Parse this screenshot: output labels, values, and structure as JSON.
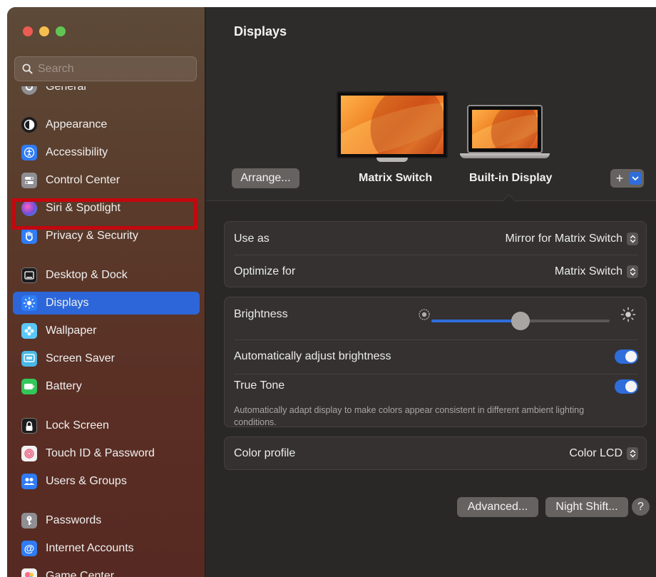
{
  "window": {
    "traffic_lights": [
      "close",
      "minimize",
      "zoom"
    ],
    "colors": {
      "close": "#ee5b52",
      "minimize": "#f5bf4f",
      "zoom": "#61c554",
      "accent": "#2f6ddb",
      "selection_frame": "#c4070e"
    }
  },
  "sidebar": {
    "search_placeholder": "Search",
    "items": [
      {
        "label": "General",
        "icon": "gear-icon",
        "color": "#8e8e93"
      },
      {
        "label": "Appearance",
        "icon": "appearance-icon",
        "color": "#1c1c1e"
      },
      {
        "label": "Accessibility",
        "icon": "accessibility-icon",
        "color": "#2f7cf6"
      },
      {
        "label": "Control Center",
        "icon": "control-center-icon",
        "color": "#8e8e93"
      },
      {
        "label": "Siri & Spotlight",
        "icon": "siri-icon",
        "color": "#6e4fd8"
      },
      {
        "label": "Privacy & Security",
        "icon": "hand-icon",
        "color": "#2f7cf6"
      },
      {
        "label": "Desktop & Dock",
        "icon": "dock-icon",
        "color": "#1c1c1e"
      },
      {
        "label": "Displays",
        "icon": "sun-icon",
        "color": "#2f7cf6",
        "selected": true
      },
      {
        "label": "Wallpaper",
        "icon": "wallpaper-icon",
        "color": "#5ac8fa"
      },
      {
        "label": "Screen Saver",
        "icon": "screen-saver-icon",
        "color": "#5ac8fa"
      },
      {
        "label": "Battery",
        "icon": "battery-icon",
        "color": "#34c759"
      },
      {
        "label": "Lock Screen",
        "icon": "lock-icon",
        "color": "#1c1c1e"
      },
      {
        "label": "Touch ID & Password",
        "icon": "fingerprint-icon",
        "color": "#f2f2f2"
      },
      {
        "label": "Users & Groups",
        "icon": "users-icon",
        "color": "#2f7cf6"
      },
      {
        "label": "Passwords",
        "icon": "key-icon",
        "color": "#8e8e93"
      },
      {
        "label": "Internet Accounts",
        "icon": "at-icon",
        "color": "#2f7cf6"
      },
      {
        "label": "Game Center",
        "icon": "game-center-icon",
        "color": "#f2f2f2"
      }
    ]
  },
  "main": {
    "title": "Displays",
    "arrange_label": "Arrange...",
    "monitors": [
      {
        "label": "Matrix Switch"
      },
      {
        "label": "Built-in Display",
        "selected": true
      }
    ],
    "add_label": "+",
    "use_as": {
      "label": "Use as",
      "value": "Mirror for Matrix Switch"
    },
    "optimize_for": {
      "label": "Optimize for",
      "value": "Matrix Switch"
    },
    "brightness": {
      "label": "Brightness",
      "level": 0.5
    },
    "auto_brightness": {
      "label": "Automatically adjust brightness",
      "on": true
    },
    "true_tone": {
      "label": "True Tone",
      "description": "Automatically adapt display to make colors appear consistent in different ambient lighting conditions.",
      "on": true
    },
    "color_profile": {
      "label": "Color profile",
      "value": "Color LCD"
    },
    "advanced_label": "Advanced...",
    "night_shift_label": "Night Shift...",
    "help_label": "?"
  }
}
